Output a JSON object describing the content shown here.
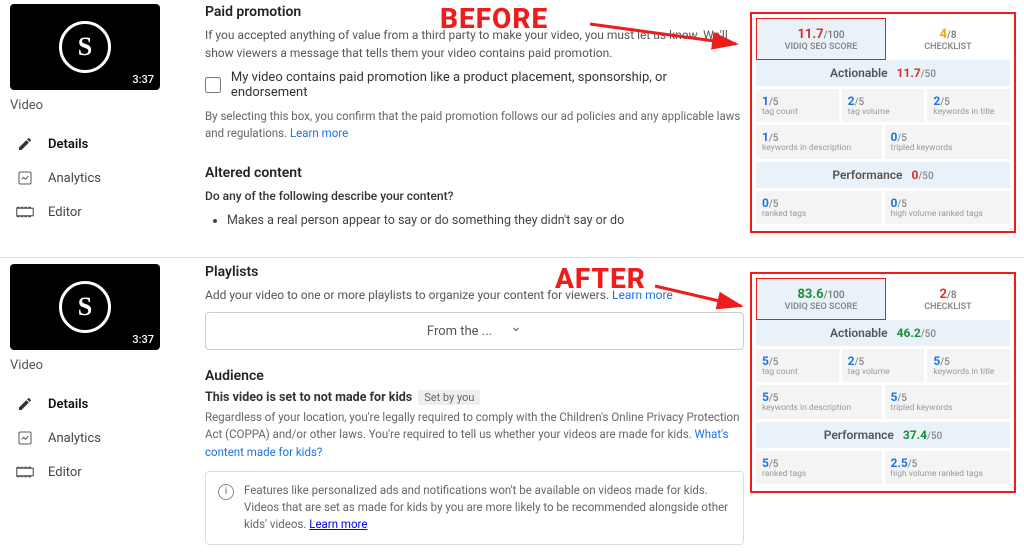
{
  "before": {
    "label": "BEFORE",
    "thumb_duration": "3:37",
    "video_label": "Video",
    "nav": {
      "details": "Details",
      "analytics": "Analytics",
      "editor": "Editor"
    },
    "paid": {
      "title": "Paid promotion",
      "desc": "If you accepted anything of value from a third party to make your video, you must let us know. We'll show viewers a message that tells them your video contains paid promotion.",
      "checkbox_label": "My video contains paid promotion like a product placement, sponsorship, or endorsement",
      "finetext": "By selecting this box, you confirm that the paid promotion follows our ad policies and any applicable laws and regulations. ",
      "learn_more": "Learn more"
    },
    "altered": {
      "title": "Altered content",
      "question": "Do any of the following describe your content?",
      "bullet": "Makes a real person appear to say or do something they didn't say or do"
    },
    "score": {
      "seo_value": "11.7",
      "seo_denom": "/100",
      "seo_label": "VIDIQ SEO SCORE",
      "checklist_value": "4",
      "checklist_denom": "/8",
      "checklist_label": "CHECKLIST",
      "actionable_label": "Actionable",
      "actionable_value": "11.7",
      "actionable_denom": "/50",
      "row1": [
        {
          "v": "1",
          "d": "/5",
          "l": "tag count"
        },
        {
          "v": "2",
          "d": "/5",
          "l": "tag volume"
        },
        {
          "v": "2",
          "d": "/5",
          "l": "keywords in title"
        }
      ],
      "row2": [
        {
          "v": "1",
          "d": "/5",
          "l": "keywords in description"
        },
        {
          "v": "0",
          "d": "/5",
          "l": "tripled keywords"
        }
      ],
      "performance_label": "Performance",
      "performance_value": "0",
      "performance_denom": "/50",
      "row3": [
        {
          "v": "0",
          "d": "/5",
          "l": "ranked tags"
        },
        {
          "v": "0",
          "d": "/5",
          "l": "high volume ranked tags"
        }
      ]
    }
  },
  "after": {
    "label": "AFTER",
    "thumb_duration": "3:37",
    "video_label": "Video",
    "nav": {
      "details": "Details",
      "analytics": "Analytics",
      "editor": "Editor"
    },
    "playlists": {
      "title": "Playlists",
      "desc": "Add your video to one or more playlists to organize your content for viewers. ",
      "learn_more": "Learn more",
      "dropdown": "From the ..."
    },
    "audience": {
      "title": "Audience",
      "sub": "This video is set to not made for kids",
      "setby": "Set by you",
      "desc": "Regardless of your location, you're legally required to comply with the Children's Online Privacy Protection Act (COPPA) and/or other laws. You're required to tell us whether your videos are made for kids. ",
      "link": "What's content made for kids?",
      "info": "Features like personalized ads and notifications won't be available on videos made for kids. Videos that are set as made for kids by you are more likely to be recommended alongside other kids' videos. ",
      "info_link": "Learn more"
    },
    "score": {
      "seo_value": "83.6",
      "seo_denom": "/100",
      "seo_label": "VIDIQ SEO SCORE",
      "checklist_value": "2",
      "checklist_denom": "/8",
      "checklist_label": "CHECKLIST",
      "actionable_label": "Actionable",
      "actionable_value": "46.2",
      "actionable_denom": "/50",
      "row1": [
        {
          "v": "5",
          "d": "/5",
          "l": "tag count"
        },
        {
          "v": "2",
          "d": "/5",
          "l": "tag volume"
        },
        {
          "v": "5",
          "d": "/5",
          "l": "keywords in title"
        }
      ],
      "row2": [
        {
          "v": "5",
          "d": "/5",
          "l": "keywords in description"
        },
        {
          "v": "5",
          "d": "/5",
          "l": "tripled keywords"
        }
      ],
      "performance_label": "Performance",
      "performance_value": "37.4",
      "performance_denom": "/50",
      "row3": [
        {
          "v": "5",
          "d": "/5",
          "l": "ranked tags"
        },
        {
          "v": "2.5",
          "d": "/5",
          "l": "high volume ranked tags"
        }
      ]
    }
  }
}
